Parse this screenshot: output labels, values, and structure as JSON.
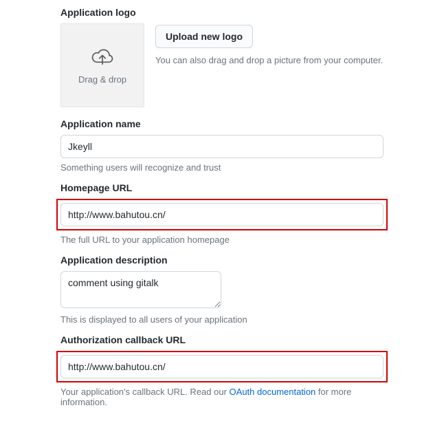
{
  "logo": {
    "label": "Application logo",
    "dropZoneLabel": "Drag & drop",
    "uploadButton": "Upload new logo",
    "uploadHint": "You can also drag and drop a picture from your computer."
  },
  "appName": {
    "label": "Application name",
    "value": "Jkeyll",
    "hint": "Something users will recognize and trust"
  },
  "homepage": {
    "label": "Homepage URL",
    "value": "http://www.bahutou.cn/",
    "hint": "The full URL to your application homepage"
  },
  "description": {
    "label": "Application description",
    "value": "comment using gitalk",
    "hint": "This is displayed to all users of your application"
  },
  "callback": {
    "label": "Authorization callback URL",
    "value": "http://www.bahutou.cn/",
    "hintPrefix": "Your application's callback URL. Read our ",
    "hintLink": "OAuth documentation",
    "hintSuffix": " for more information."
  }
}
